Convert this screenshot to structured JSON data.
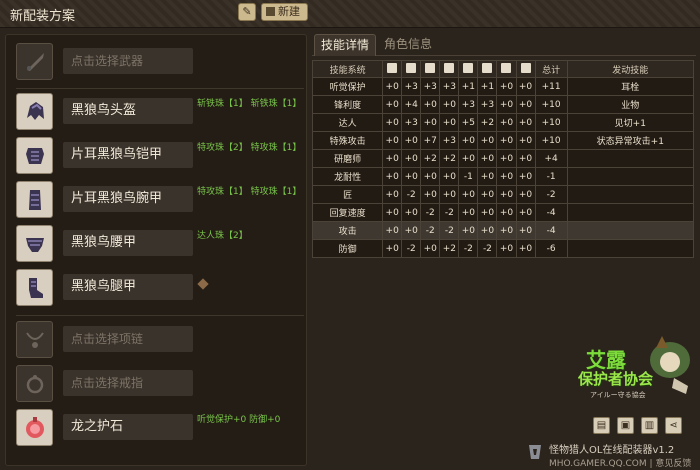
{
  "header": {
    "title": "新配装方案",
    "edit_icon": "pencil-icon",
    "new_label": "新建"
  },
  "slots": [
    {
      "name": "点击选择武器",
      "placeholder": true,
      "decos": "",
      "icon": "weapon-icon"
    },
    {
      "name": "黑狼鸟头盔",
      "placeholder": false,
      "decos": "斩铁珠【1】 斩铁珠【1】",
      "icon": "helmet-icon"
    },
    {
      "name": "片耳黑狼鸟铠甲",
      "placeholder": false,
      "decos": "特攻珠【2】 特攻珠【1】",
      "icon": "chest-armor-icon"
    },
    {
      "name": "片耳黑狼鸟腕甲",
      "placeholder": false,
      "decos": "特攻珠【1】 特攻珠【1】",
      "icon": "arm-armor-icon"
    },
    {
      "name": "黑狼鸟腰甲",
      "placeholder": false,
      "decos": "达人珠【2】",
      "icon": "waist-armor-icon"
    },
    {
      "name": "黑狼鸟腿甲",
      "placeholder": false,
      "decos": "",
      "icon": "leg-armor-icon"
    },
    {
      "name": "点击选择项链",
      "placeholder": true,
      "decos": "",
      "icon": "necklace-icon"
    },
    {
      "name": "点击选择戒指",
      "placeholder": true,
      "decos": "",
      "icon": "ring-icon"
    },
    {
      "name": "龙之护石",
      "placeholder": false,
      "decos": "听觉保护+0 防御+0",
      "icon": "talisman-icon"
    }
  ],
  "tabs": [
    {
      "label": "技能详情",
      "active": true
    },
    {
      "label": "角色信息",
      "active": false
    }
  ],
  "table": {
    "headers": [
      "技能系统",
      "",
      "",
      "",
      "",
      "",
      "",
      "",
      "总计",
      "发动技能"
    ],
    "header_icons": [
      "weapon-icon",
      "helmet-icon",
      "chest-armor-icon",
      "arm-armor-icon",
      "waist-armor-icon",
      "leg-armor-icon",
      "necklace-icon",
      "ring-icon"
    ],
    "rows": [
      {
        "skill": "听觉保护",
        "v": [
          "+0",
          "+3",
          "+3",
          "+3",
          "+1",
          "+1",
          "+0",
          "+0"
        ],
        "total": "+11",
        "fire": "耳栓",
        "hl": false
      },
      {
        "skill": "锋利度",
        "v": [
          "+0",
          "+4",
          "+0",
          "+0",
          "+3",
          "+3",
          "+0",
          "+0"
        ],
        "total": "+10",
        "fire": "业物",
        "hl": false
      },
      {
        "skill": "达人",
        "v": [
          "+0",
          "+3",
          "+0",
          "+0",
          "+5",
          "+2",
          "+0",
          "+0"
        ],
        "total": "+10",
        "fire": "见切+1",
        "hl": false
      },
      {
        "skill": "特殊攻击",
        "v": [
          "+0",
          "+0",
          "+7",
          "+3",
          "+0",
          "+0",
          "+0",
          "+0"
        ],
        "total": "+10",
        "fire": "状态异常攻击+1",
        "hl": false
      },
      {
        "skill": "研磨师",
        "v": [
          "+0",
          "+0",
          "+2",
          "+2",
          "+0",
          "+0",
          "+0",
          "+0"
        ],
        "total": "+4",
        "fire": "",
        "hl": false
      },
      {
        "skill": "龙耐性",
        "v": [
          "+0",
          "+0",
          "+0",
          "+0",
          "-1",
          "+0",
          "+0",
          "+0"
        ],
        "total": "-1",
        "fire": "",
        "hl": false
      },
      {
        "skill": "匠",
        "v": [
          "+0",
          "-2",
          "+0",
          "+0",
          "+0",
          "+0",
          "+0",
          "+0"
        ],
        "total": "-2",
        "fire": "",
        "hl": false
      },
      {
        "skill": "回复速度",
        "v": [
          "+0",
          "+0",
          "-2",
          "-2",
          "+0",
          "+0",
          "+0",
          "+0"
        ],
        "total": "-4",
        "fire": "",
        "hl": false
      },
      {
        "skill": "攻击",
        "v": [
          "+0",
          "+0",
          "-2",
          "-2",
          "+0",
          "+0",
          "+0",
          "+0"
        ],
        "total": "-4",
        "fire": "",
        "hl": true
      },
      {
        "skill": "防御",
        "v": [
          "+0",
          "-2",
          "+0",
          "+2",
          "-2",
          "-2",
          "+0",
          "+0"
        ],
        "total": "-6",
        "fire": "",
        "hl": false
      }
    ]
  },
  "logo": {
    "line1": "艾露",
    "line2": "保护者协会",
    "sub": "アイルー守る協会"
  },
  "footer": {
    "buttons": [
      "save-icon",
      "clipboard-icon",
      "trash-icon",
      "share-icon"
    ],
    "brand_line1": "怪物猎人OL在线配装器v1.2",
    "brand_line2": "MHO.GAMER.QQ.COM | 意见反馈"
  },
  "colors": {
    "accent": "#79c44a",
    "button": "#cdb98e",
    "bg": "#2b241c"
  }
}
